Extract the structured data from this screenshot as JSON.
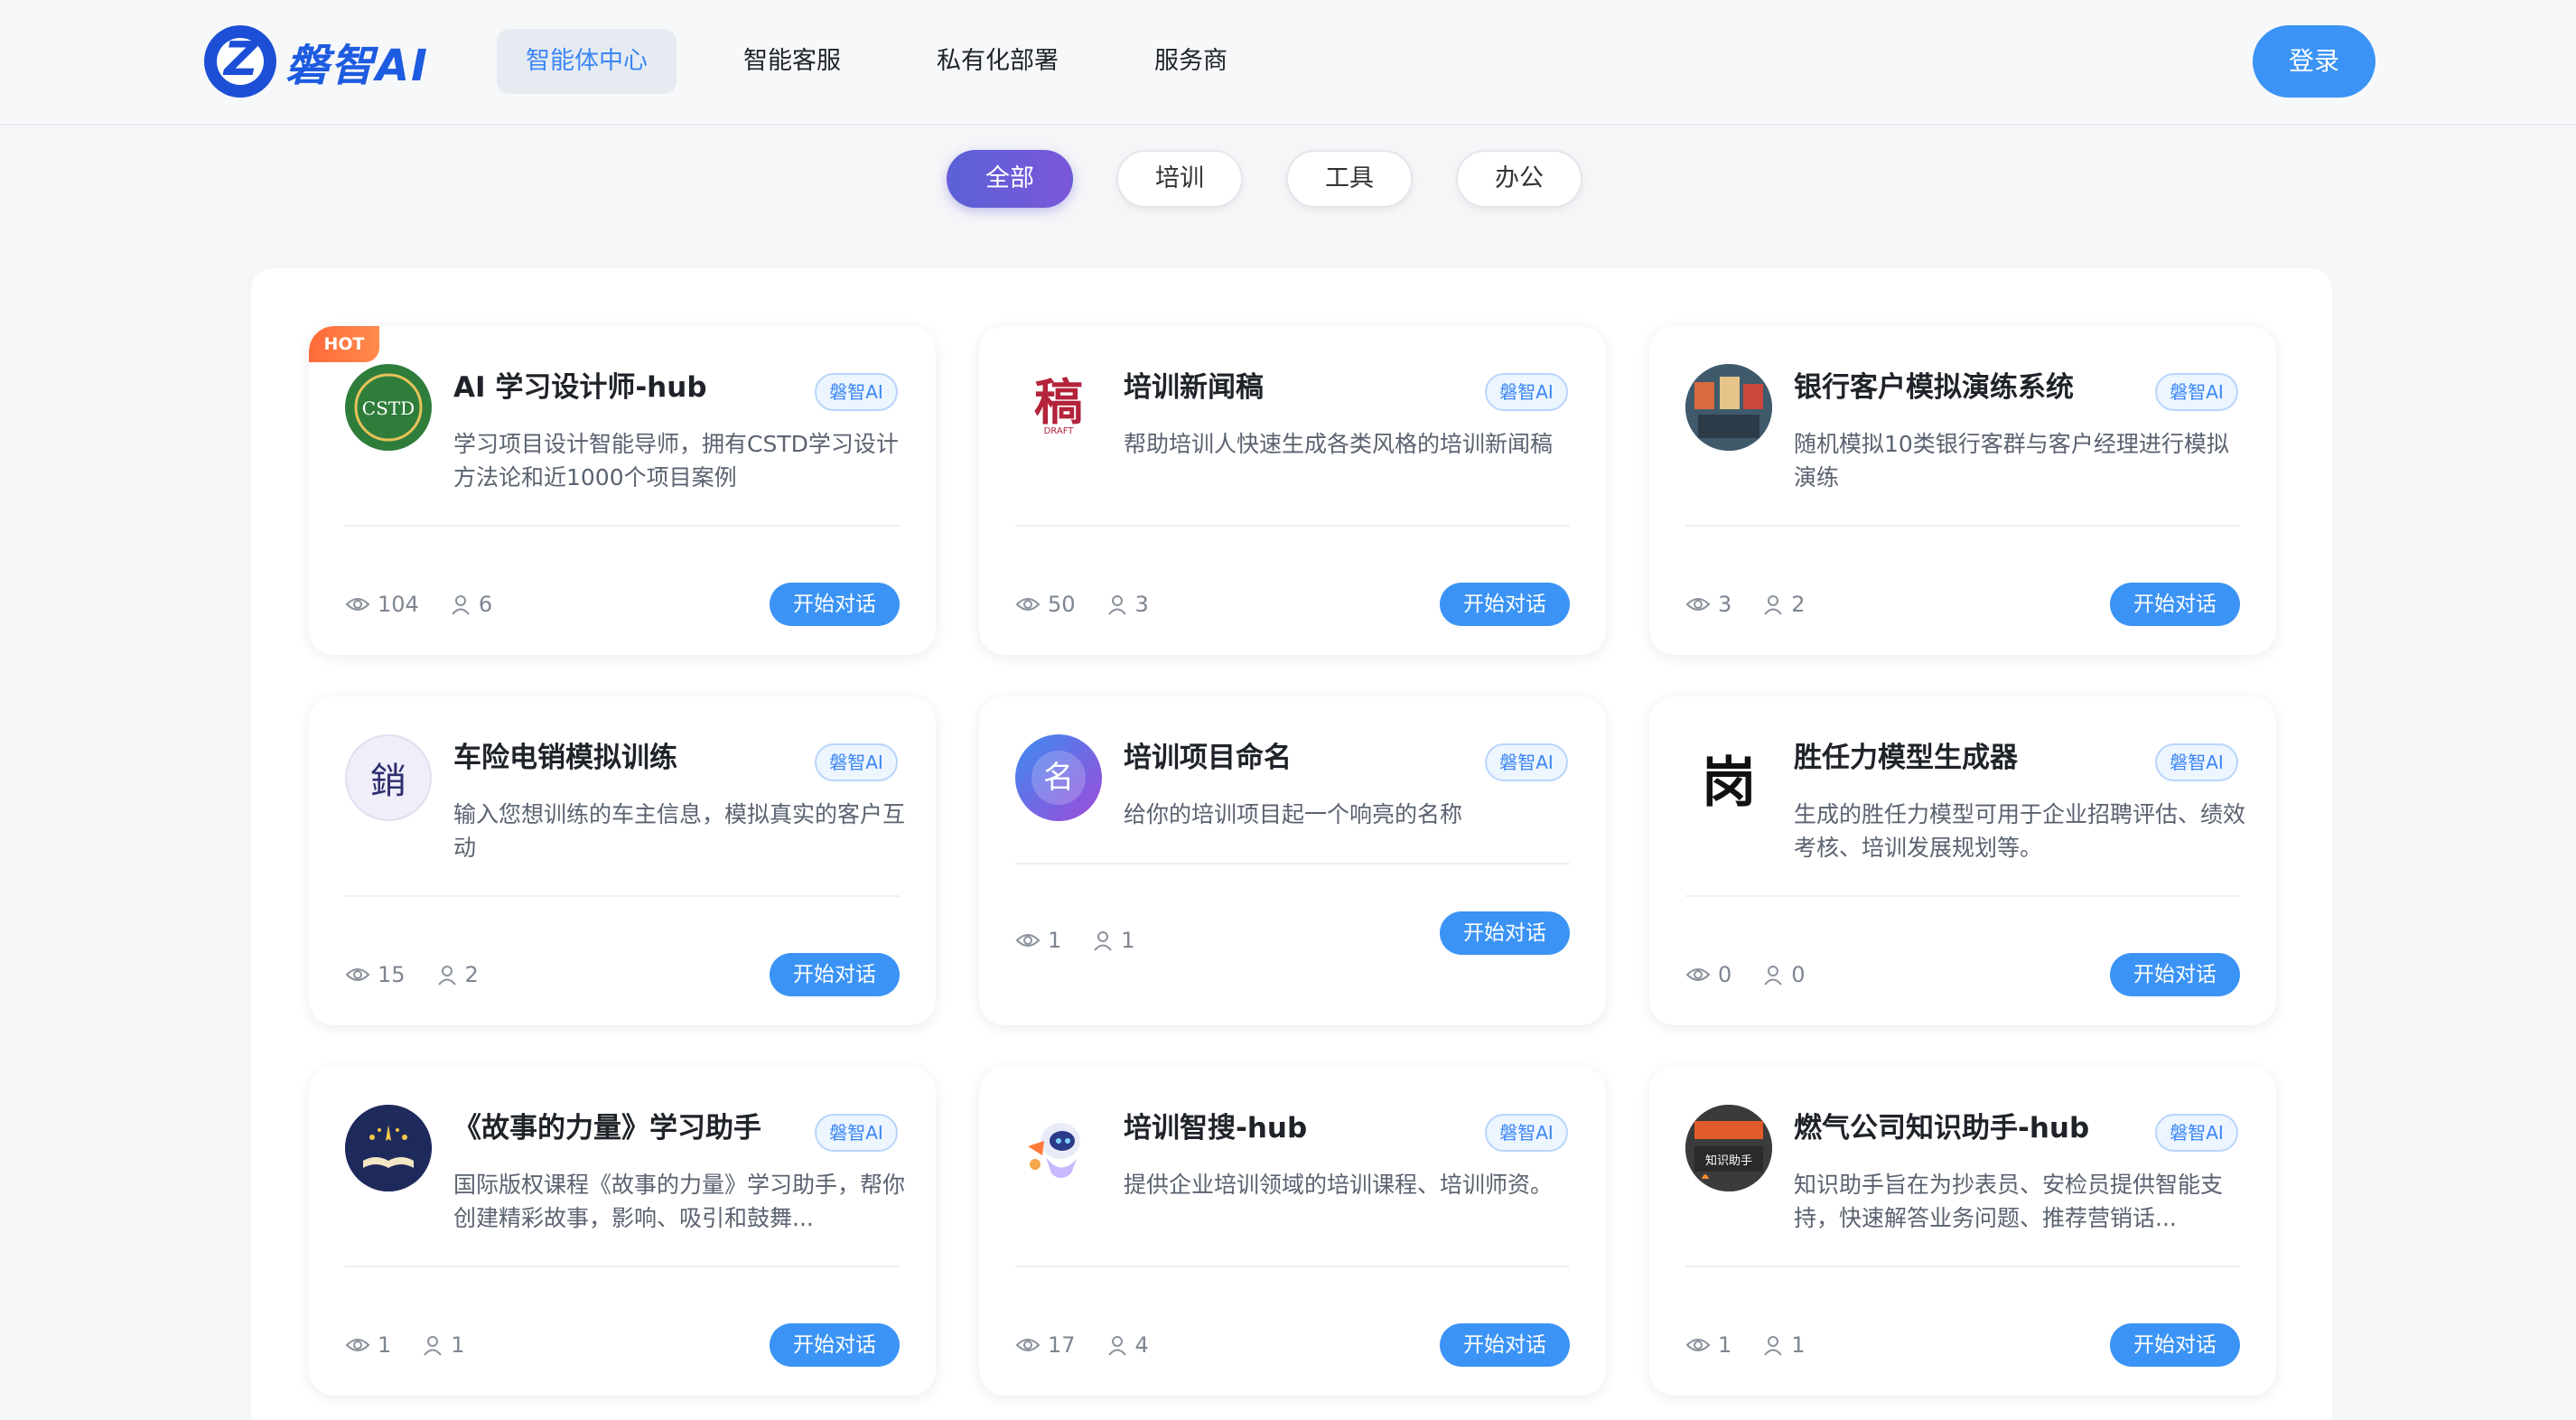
{
  "header": {
    "logo_text": "磐智AI",
    "nav": [
      "智能体中心",
      "智能客服",
      "私有化部署",
      "服务商"
    ],
    "login_label": "登录"
  },
  "filters": [
    "全部",
    "培训",
    "工具",
    "办公"
  ],
  "cards": [
    {
      "title": "AI 学习设计师-hub",
      "brand": "磐智AI",
      "desc": "学习项目设计智能导师，拥有CSTD学习设计方法论和近1000个项目案例",
      "views": "104",
      "users": "6",
      "cta": "开始对话",
      "hot": "HOT",
      "avatar_text": "CSTD"
    },
    {
      "title": "培训新闻稿",
      "brand": "磐智AI",
      "desc": "帮助培训人快速生成各类风格的培训新闻稿",
      "views": "50",
      "users": "3",
      "cta": "开始对话",
      "avatar_text": "稿",
      "avatar_sub": "DRAFT"
    },
    {
      "title": "银行客户模拟演练系统",
      "brand": "磐智AI",
      "desc": "随机模拟10类银行客群与客户经理进行模拟演练",
      "views": "3",
      "users": "2",
      "cta": "开始对话"
    },
    {
      "title": "车险电销模拟训练",
      "brand": "磐智AI",
      "desc": "输入您想训练的车主信息，模拟真实的客户互动",
      "views": "15",
      "users": "2",
      "cta": "开始对话",
      "avatar_text": "銷"
    },
    {
      "title": "培训项目命名",
      "brand": "磐智AI",
      "desc": "给你的培训项目起一个响亮的名称",
      "views": "1",
      "users": "1",
      "cta": "开始对话",
      "avatar_text": "名"
    },
    {
      "title": "胜任力模型生成器",
      "brand": "磐智AI",
      "desc": "生成的胜任力模型可用于企业招聘评估、绩效考核、培训发展规划等。",
      "views": "0",
      "users": "0",
      "cta": "开始对话",
      "avatar_text": "岗"
    },
    {
      "title": "《故事的力量》学习助手",
      "brand": "磐智AI",
      "desc": "国际版权课程《故事的力量》学习助手，帮你创建精彩故事，影响、吸引和鼓舞...",
      "views": "1",
      "users": "1",
      "cta": "开始对话"
    },
    {
      "title": "培训智搜-hub",
      "brand": "磐智AI",
      "desc": "提供企业培训领域的培训课程、培训师资。",
      "views": "17",
      "users": "4",
      "cta": "开始对话"
    },
    {
      "title": "燃气公司知识助手-hub",
      "brand": "磐智AI",
      "desc": "知识助手旨在为抄表员、安检员提供智能支持，快速解答业务问题、推荐营销话...",
      "views": "1",
      "users": "1",
      "cta": "开始对话",
      "avatar_text": "知识助手"
    }
  ]
}
